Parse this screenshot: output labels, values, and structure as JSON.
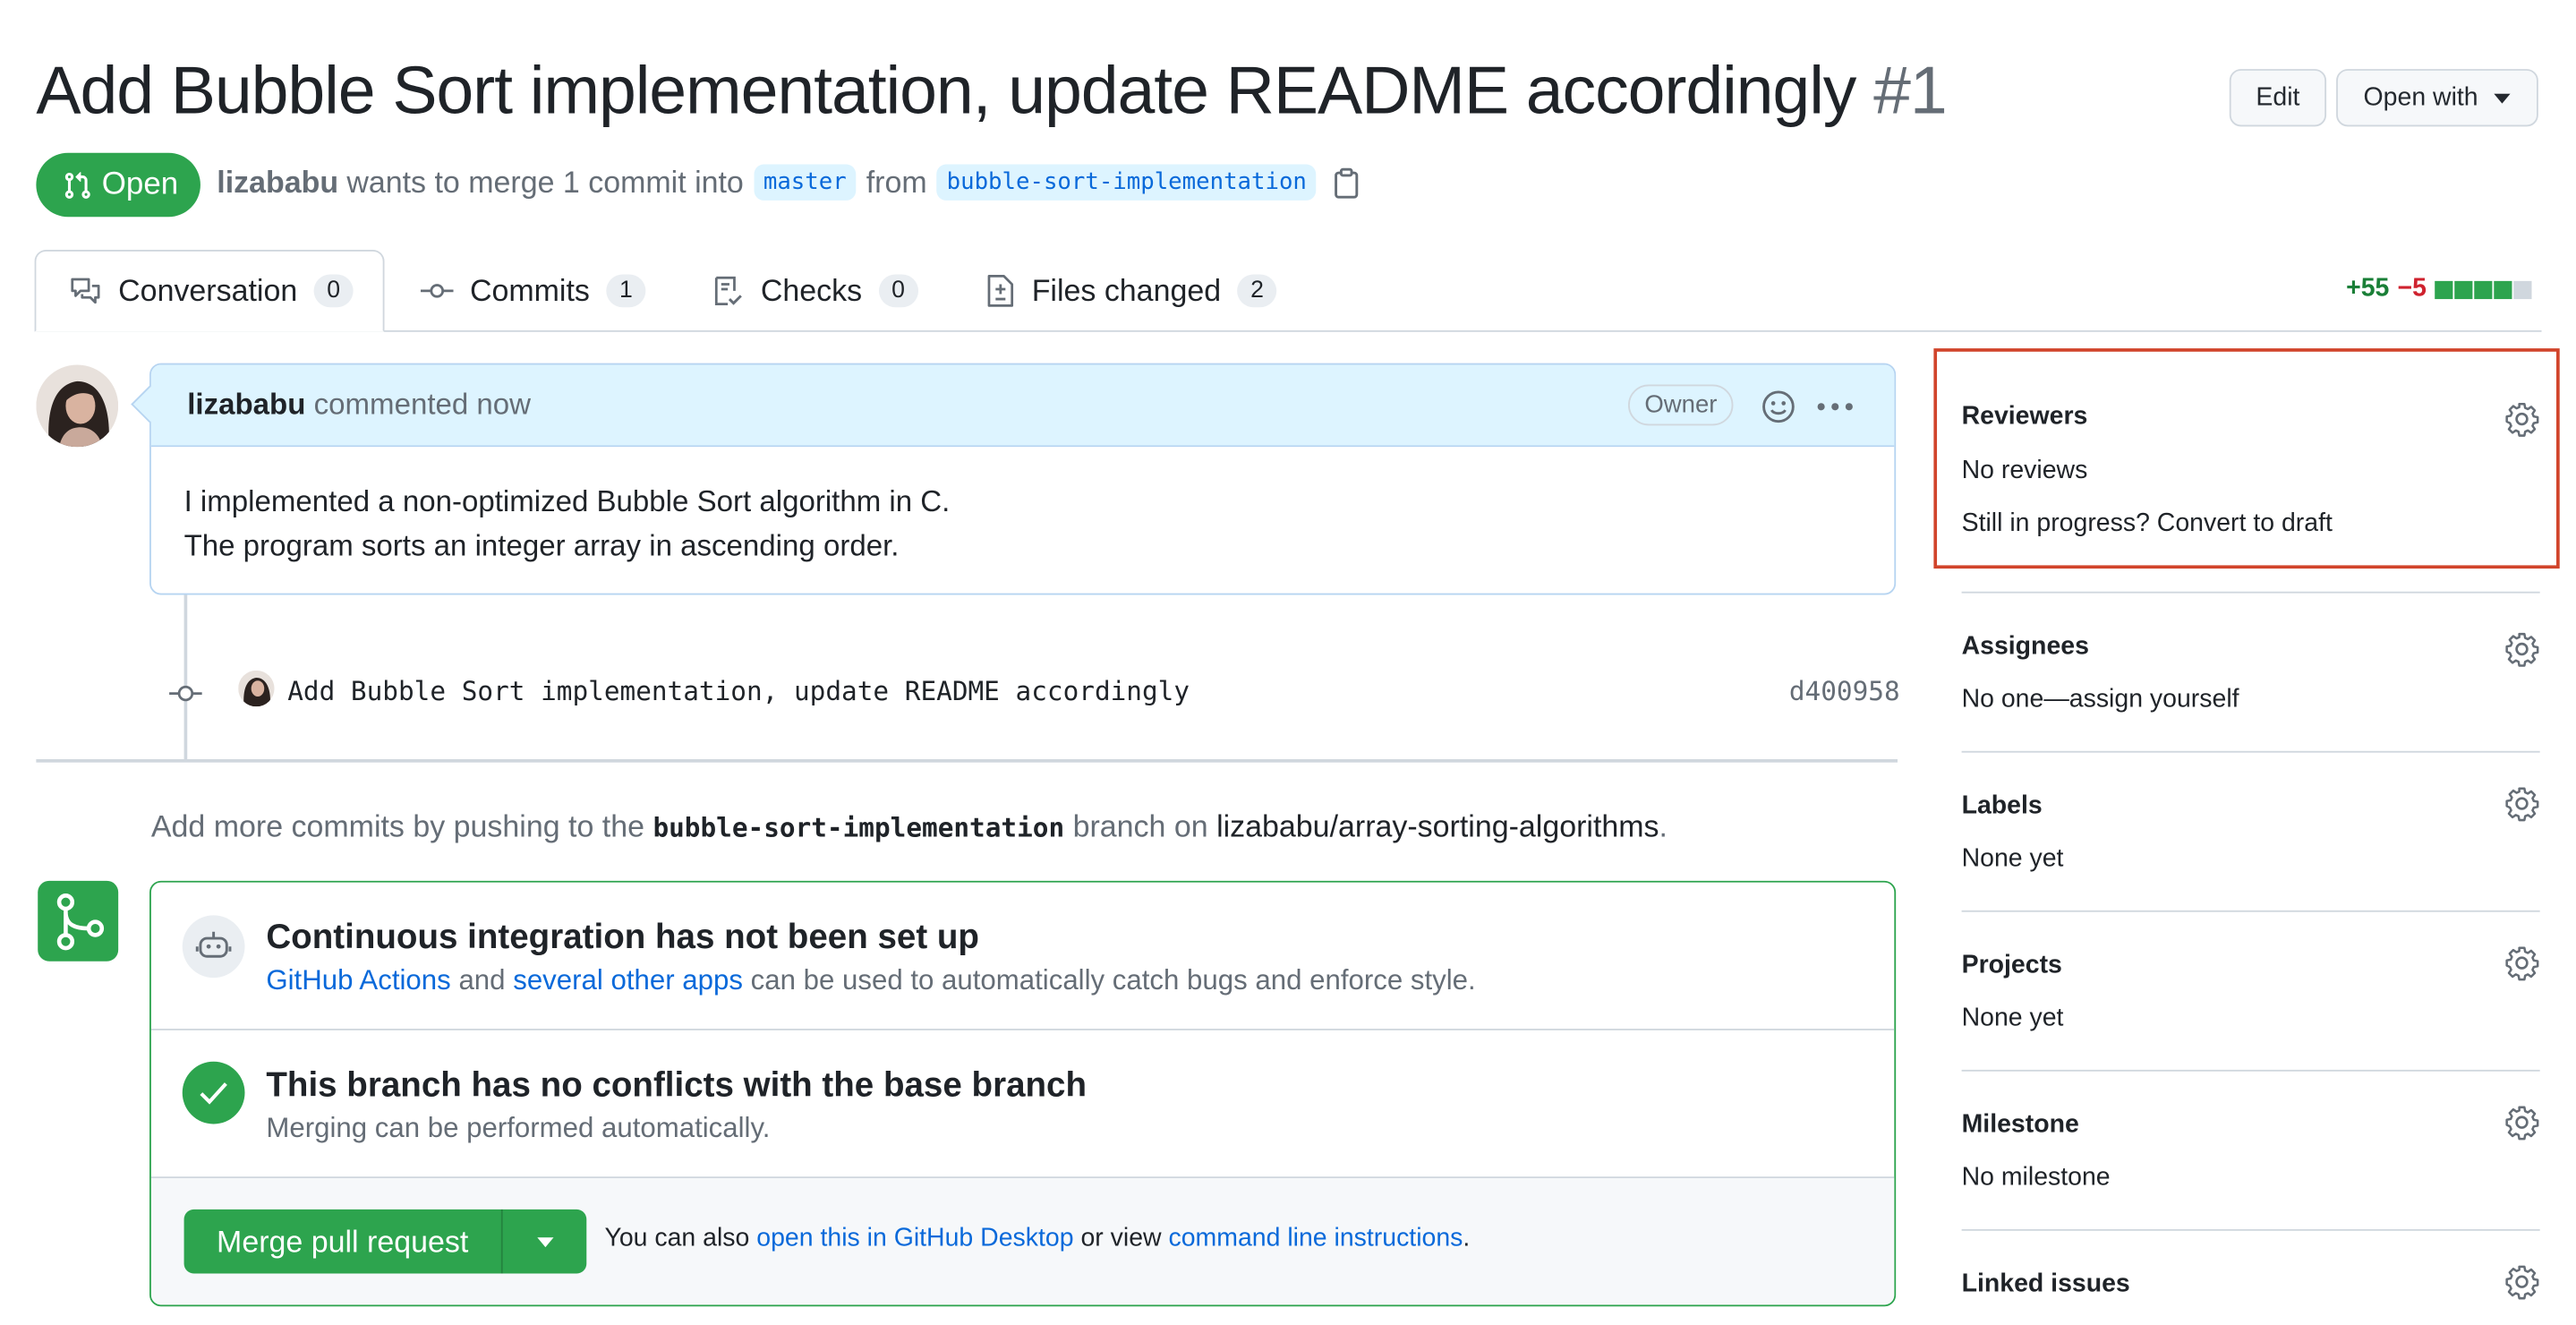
{
  "header": {
    "title": "Add Bubble Sort implementation, update README accordingly",
    "number": "#1",
    "edit_label": "Edit",
    "open_with_label": "Open with"
  },
  "pr_meta": {
    "state": "Open",
    "author": "lizababu",
    "action_text": "wants to merge 1 commit into",
    "base_branch": "master",
    "from_text": "from",
    "head_branch": "bubble-sort-implementation"
  },
  "tabs": [
    {
      "label": "Conversation",
      "count": "0"
    },
    {
      "label": "Commits",
      "count": "1"
    },
    {
      "label": "Checks",
      "count": "0"
    },
    {
      "label": "Files changed",
      "count": "2"
    }
  ],
  "diffstat": {
    "additions": "+55",
    "deletions": "−5",
    "blocks": [
      "green",
      "green",
      "green",
      "green",
      "gray"
    ]
  },
  "comment": {
    "author": "lizababu",
    "meta": "commented now",
    "role": "Owner",
    "body_lines": [
      "I implemented a non-optimized Bubble Sort algorithm in C.",
      "The program sorts an integer array in ascending order."
    ]
  },
  "commit": {
    "message": "Add Bubble Sort implementation, update README accordingly",
    "sha": "d400958"
  },
  "push_hint": {
    "prefix": "Add more commits by pushing to the",
    "branch": "bubble-sort-implementation",
    "middle": "branch on",
    "repo": "lizababu/array-sorting-algorithms",
    "suffix": "."
  },
  "ci": {
    "title": "Continuous integration has not been set up",
    "link1": "GitHub Actions",
    "and": "and",
    "link2": "several other apps",
    "rest": "can be used to automatically catch bugs and enforce style."
  },
  "conflicts": {
    "title": "This branch has no conflicts with the base branch",
    "sub": "Merging can be performed automatically."
  },
  "merge": {
    "button_label": "Merge pull request",
    "also_text": "You can also",
    "link1": "open this in GitHub Desktop",
    "or_view": "or view",
    "link2": "command line instructions",
    "end": "."
  },
  "sidebar": {
    "reviewers": {
      "title": "Reviewers",
      "value": "No reviews",
      "draft_text": "Still in progress? Convert to draft"
    },
    "assignees": {
      "title": "Assignees",
      "value": "No one—assign yourself"
    },
    "labels": {
      "title": "Labels",
      "value": "None yet"
    },
    "projects": {
      "title": "Projects",
      "value": "None yet"
    },
    "milestone": {
      "title": "Milestone",
      "value": "No milestone"
    },
    "linked_issues": {
      "title": "Linked issues"
    }
  },
  "colors": {
    "success": "#2da44e",
    "link": "#0969da",
    "danger": "#cf222e",
    "highlight": "#d1442b"
  }
}
